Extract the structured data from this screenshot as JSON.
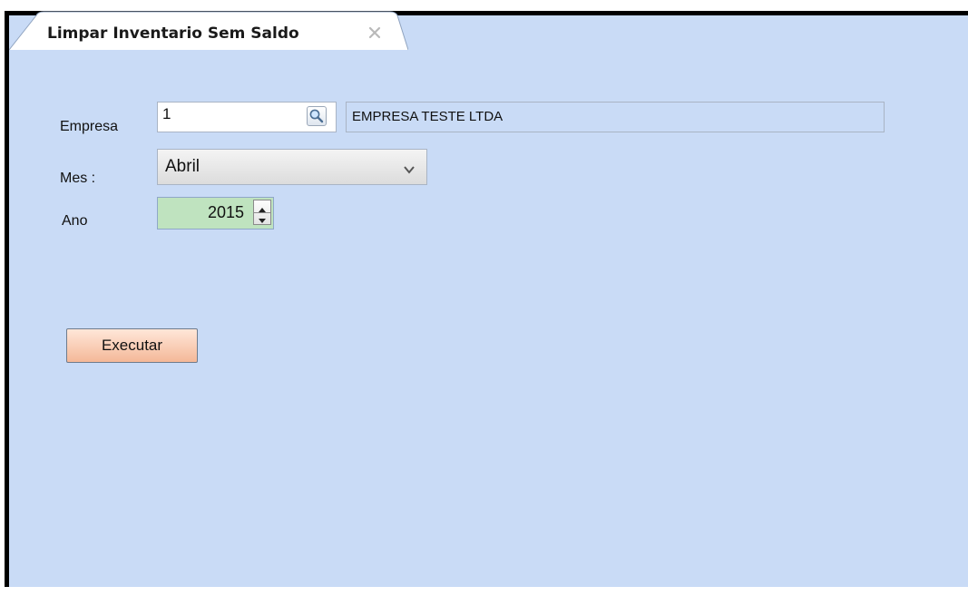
{
  "tab": {
    "title": "Limpar Inventario Sem Saldo",
    "close_icon": "close-x-icon"
  },
  "form": {
    "empresa": {
      "label": "Empresa",
      "code": "1",
      "search_icon": "magnifier-icon",
      "name": "EMPRESA TESTE LTDA"
    },
    "mes": {
      "label": "Mes :",
      "value": "Abril",
      "dropdown_icon": "chevron-down-icon"
    },
    "ano": {
      "label": "Ano",
      "value": "2015",
      "spin_up_icon": "spin-up-icon",
      "spin_down_icon": "spin-down-icon"
    }
  },
  "actions": {
    "execute_label": "Executar"
  },
  "colors": {
    "background": "#c9dbf6",
    "ano_field": "#bfe3bf",
    "execute_button": "#f4b898"
  }
}
